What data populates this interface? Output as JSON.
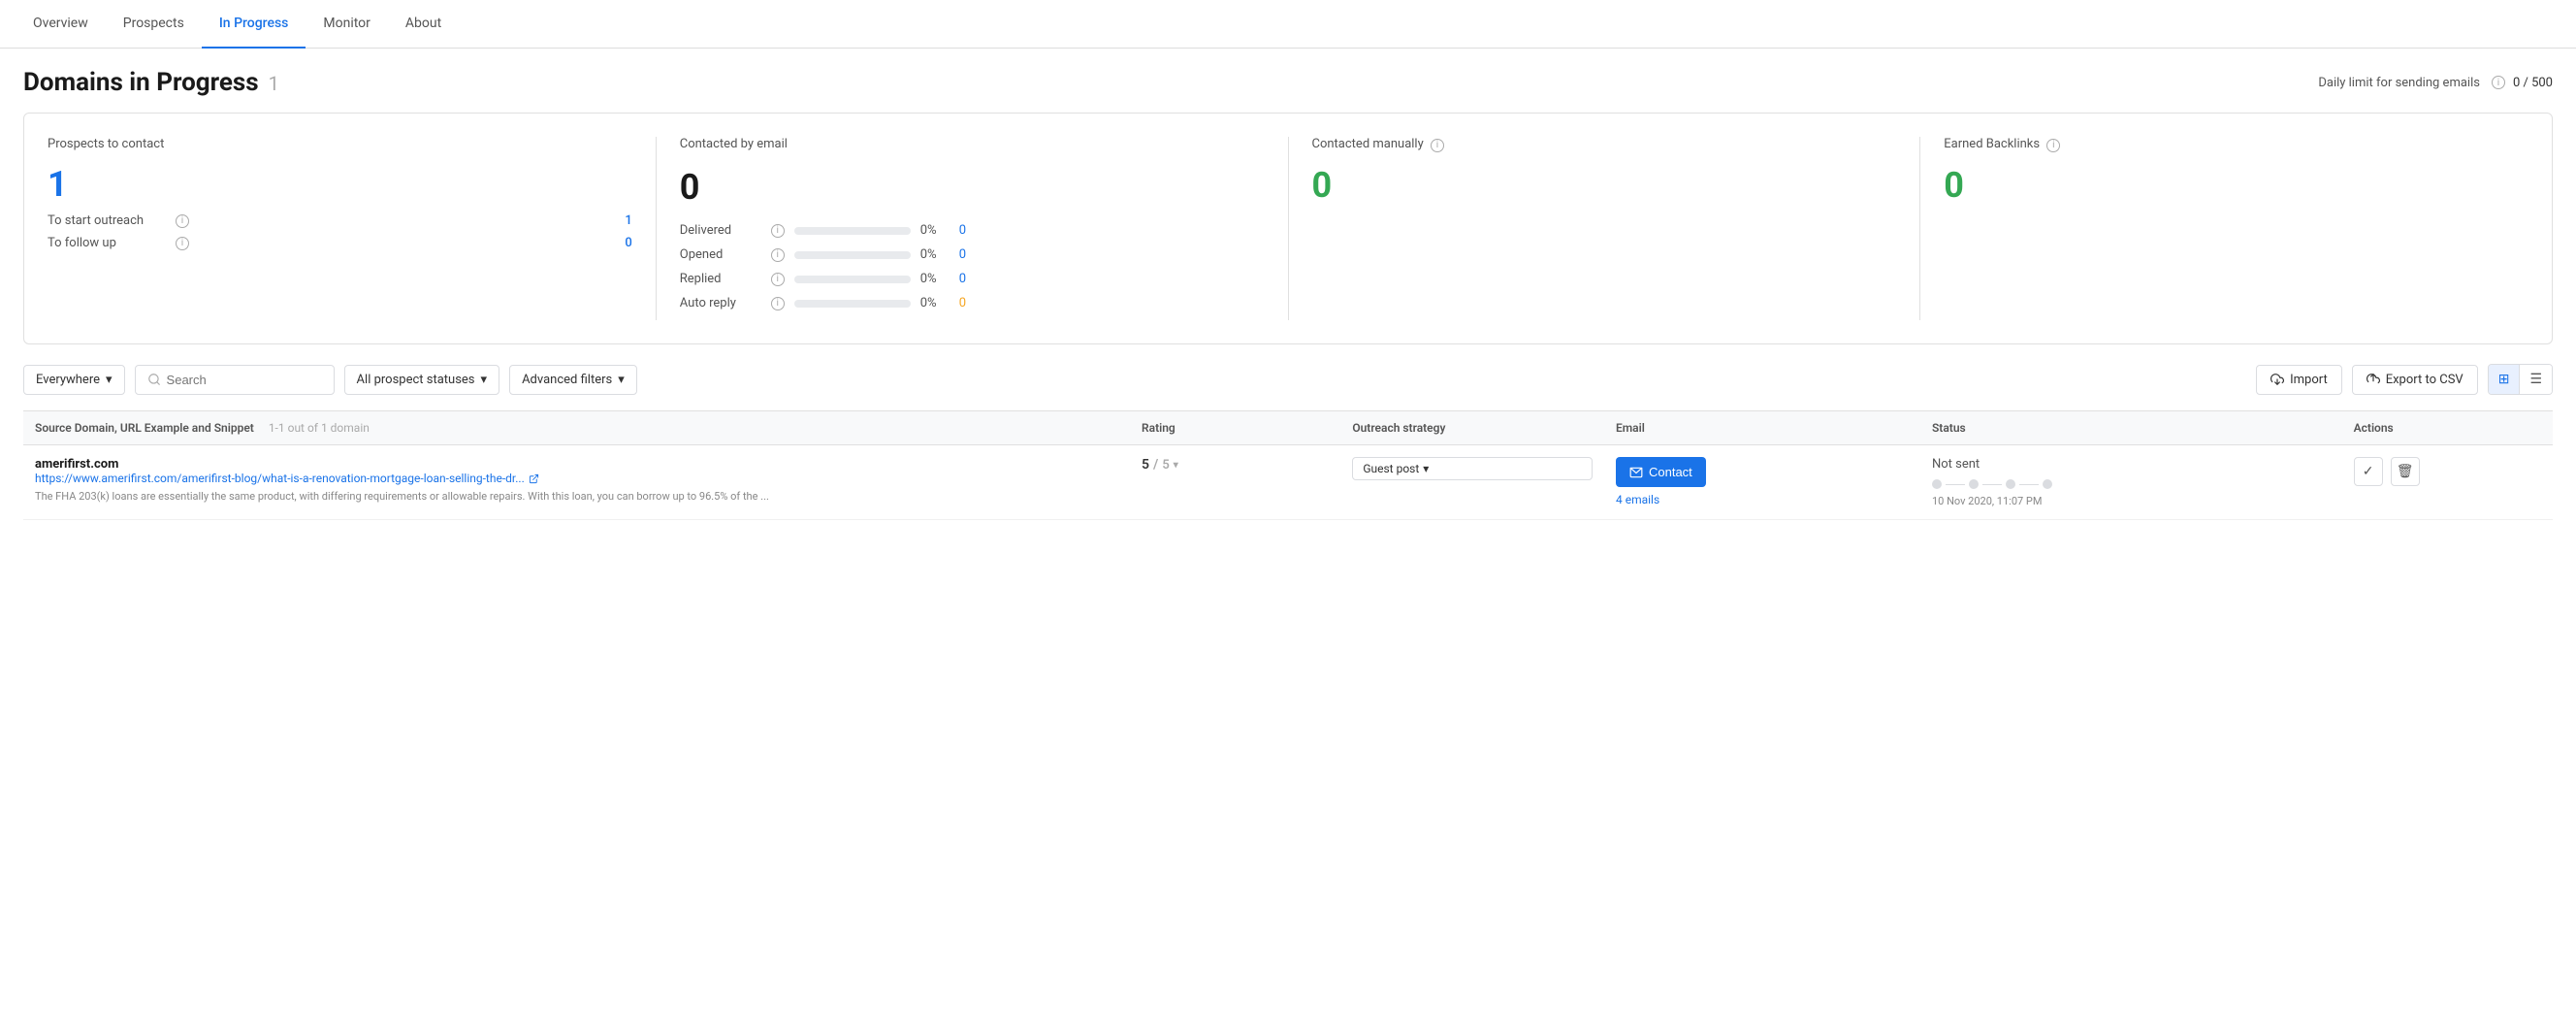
{
  "tabs": [
    {
      "label": "Overview",
      "active": false
    },
    {
      "label": "Prospects",
      "active": false
    },
    {
      "label": "In Progress",
      "active": true
    },
    {
      "label": "Monitor",
      "active": false
    },
    {
      "label": "About",
      "active": false
    }
  ],
  "page": {
    "title": "Domains in Progress",
    "count": "1",
    "daily_limit_label": "Daily limit for sending emails",
    "daily_limit_value": "0 / 500"
  },
  "stats": {
    "prospects": {
      "title": "Prospects to contact",
      "big_number": "1",
      "rows": [
        {
          "label": "To start outreach",
          "value": "1",
          "orange": false
        },
        {
          "label": "To follow up",
          "value": "0",
          "orange": false
        }
      ]
    },
    "email": {
      "title": "Contacted by email",
      "big_number": "0",
      "rows": [
        {
          "label": "Delivered",
          "pct": "0%",
          "count": "0",
          "orange": false
        },
        {
          "label": "Opened",
          "pct": "0%",
          "count": "0",
          "orange": false
        },
        {
          "label": "Replied",
          "pct": "0%",
          "count": "0",
          "orange": false
        },
        {
          "label": "Auto reply",
          "pct": "0%",
          "count": "0",
          "orange": true
        }
      ]
    },
    "manual": {
      "title": "Contacted manually",
      "big_number": "0"
    },
    "backlinks": {
      "title": "Earned Backlinks",
      "big_number": "0"
    }
  },
  "filters": {
    "location_label": "Everywhere",
    "search_placeholder": "Search",
    "status_label": "All prospect statuses",
    "advanced_label": "Advanced filters",
    "import_label": "Import",
    "export_label": "Export to CSV"
  },
  "table": {
    "columns": [
      "Source Domain, URL Example and Snippet",
      "1-1 out of 1 domain",
      "Rating",
      "Outreach strategy",
      "Email",
      "Status",
      "Actions"
    ],
    "rows": [
      {
        "domain": "amerifirst.com",
        "url": "https://www.amerifirst.com/amerifirst-blog/what-is-a-renovation-mortgage-loan-selling-the-dr...",
        "snippet": "The FHA 203(k) loans are essentially the same product, with differing requirements or allowable repairs. With this loan, you can borrow up to 96.5% of the ...",
        "rating_val": "5",
        "rating_max": "5",
        "outreach": "Guest post",
        "email_action": "Contact",
        "email_count": "4 emails",
        "status_label": "Not sent",
        "status_date": "10 Nov 2020, 11:07 PM"
      }
    ]
  }
}
